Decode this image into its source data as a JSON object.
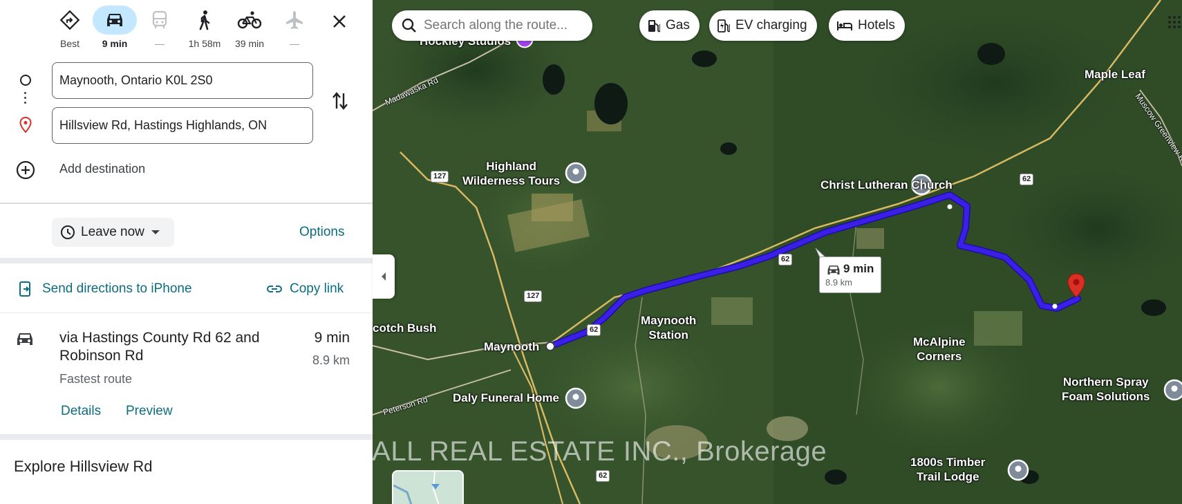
{
  "travel_modes": [
    {
      "name": "best",
      "label": "Best",
      "active": false,
      "disabled": false
    },
    {
      "name": "driving",
      "label": "9 min",
      "active": true,
      "disabled": false
    },
    {
      "name": "transit",
      "label": "—",
      "active": false,
      "disabled": true
    },
    {
      "name": "walking",
      "label": "1h 58m",
      "active": false,
      "disabled": false
    },
    {
      "name": "cycling",
      "label": "39 min",
      "active": false,
      "disabled": false
    },
    {
      "name": "flights",
      "label": "—",
      "active": false,
      "disabled": true
    }
  ],
  "directions": {
    "origin": "Maynooth, Ontario K0L 2S0",
    "destination": "Hillsview Rd, Hastings Highlands, ON",
    "add_destination": "Add destination"
  },
  "departure": {
    "label": "Leave now",
    "options_label": "Options"
  },
  "share": {
    "send_label": "Send directions to iPhone",
    "copy_label": "Copy link"
  },
  "route": {
    "title": "via Hastings County Rd 62 and Robinson Rd",
    "subtitle": "Fastest route",
    "time": "9 min",
    "distance": "8.9 km",
    "details_label": "Details",
    "preview_label": "Preview"
  },
  "explore_title": "Explore Hillsview Rd",
  "map": {
    "search_placeholder": "Search along the route...",
    "chips": [
      "Gas",
      "EV charging",
      "Hotels"
    ],
    "route_callout": {
      "time": "9 min",
      "distance": "8.9 km"
    },
    "place_labels": {
      "hockley": "Hockley Studios",
      "highland": "Highland\nWilderness Tours",
      "christ": "Christ Lutheran Church",
      "maple": "Maple Leaf",
      "maynooth": "Maynooth",
      "station": "Maynooth\nStation",
      "mcalpine": "McAlpine\nCorners",
      "scotch": "cotch Bush",
      "daly": "Daly Funeral Home",
      "northern": "Northern Spray\nFoam Solutions",
      "timber": "1800s Timber\nTrail Lodge"
    },
    "road_labels": {
      "madawaska": "Madawaska Rd",
      "peterson": "Peterson Rd",
      "muscow": "Muscow Greenview Rd"
    },
    "shields": {
      "s127a": "127",
      "s127b": "127",
      "s62a": "62",
      "s62b": "62",
      "s62c": "62",
      "s62d": "62"
    },
    "watermark": "BALL REAL ESTATE INC., Brokerage",
    "colors": {
      "route": "#3c1fe6",
      "route_outline": "#1a0fa0",
      "destination_pin": "#d93025",
      "poi": "#7e8b98",
      "link": "#0b6d7f",
      "active_mode": "#c2e7ff"
    }
  }
}
